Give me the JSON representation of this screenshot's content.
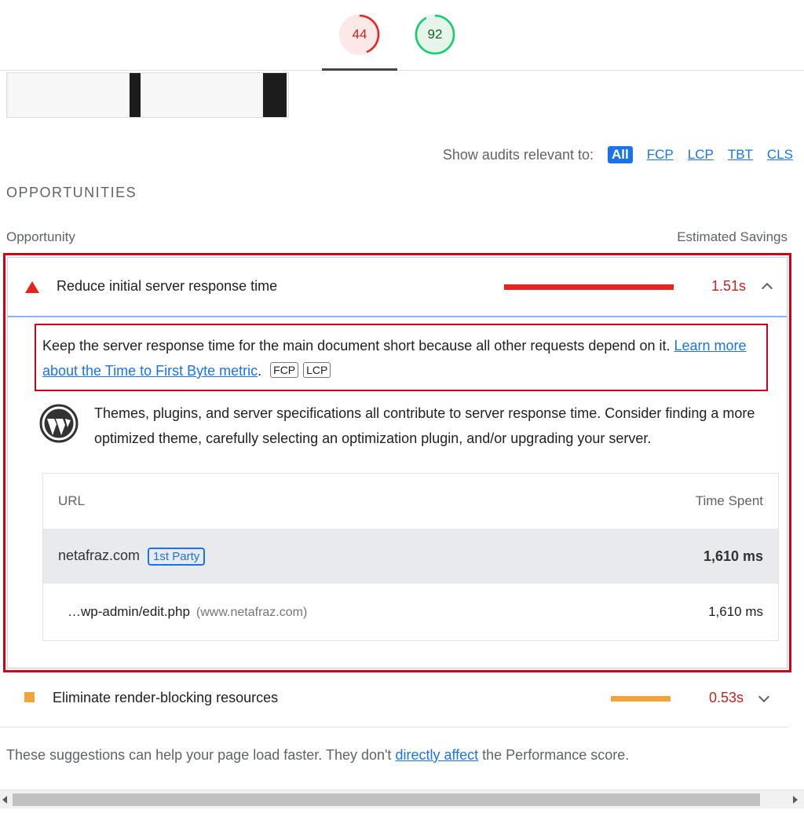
{
  "scores": [
    {
      "value": "44",
      "color": "#e8231f",
      "bg": "#fce8e6"
    },
    {
      "value": "92",
      "color": "#0cce6b",
      "bg": "#e6f4ea"
    }
  ],
  "filters": {
    "label": "Show audits relevant to:",
    "items": [
      "All",
      "FCP",
      "LCP",
      "TBT",
      "CLS"
    ],
    "active": "All"
  },
  "section_title": "OPPORTUNITIES",
  "columns": {
    "left": "Opportunity",
    "right": "Estimated Savings"
  },
  "opportunity1": {
    "title": "Reduce initial server response time",
    "saving": "1.51s",
    "severity_color": "#e8231f",
    "description": "Keep the server response time for the main document short because all other requests depend on it.",
    "link_text": "Learn more about the Time to First Byte metric",
    "period": ".",
    "tags": [
      "FCP",
      "LCP"
    ],
    "wp_hint": "Themes, plugins, and server specifications all contribute to server response time. Consider finding a more optimized theme, carefully selecting an optimization plugin, and/or upgrading your server.",
    "table": {
      "headers": {
        "url": "URL",
        "time": "Time Spent"
      },
      "group": {
        "domain": "netafraz.com",
        "badge": "1st Party",
        "time": "1,610 ms"
      },
      "row": {
        "path": "…wp-admin/edit.php",
        "host": "(www.netafraz.com)",
        "time": "1,610 ms"
      }
    }
  },
  "opportunity2": {
    "title": "Eliminate render-blocking resources",
    "saving": "0.53s",
    "severity_color": "#f2a33a"
  },
  "footnote": {
    "before": "These suggestions can help your page load faster. They don't ",
    "link": "directly affect",
    "after": " the Performance score."
  }
}
